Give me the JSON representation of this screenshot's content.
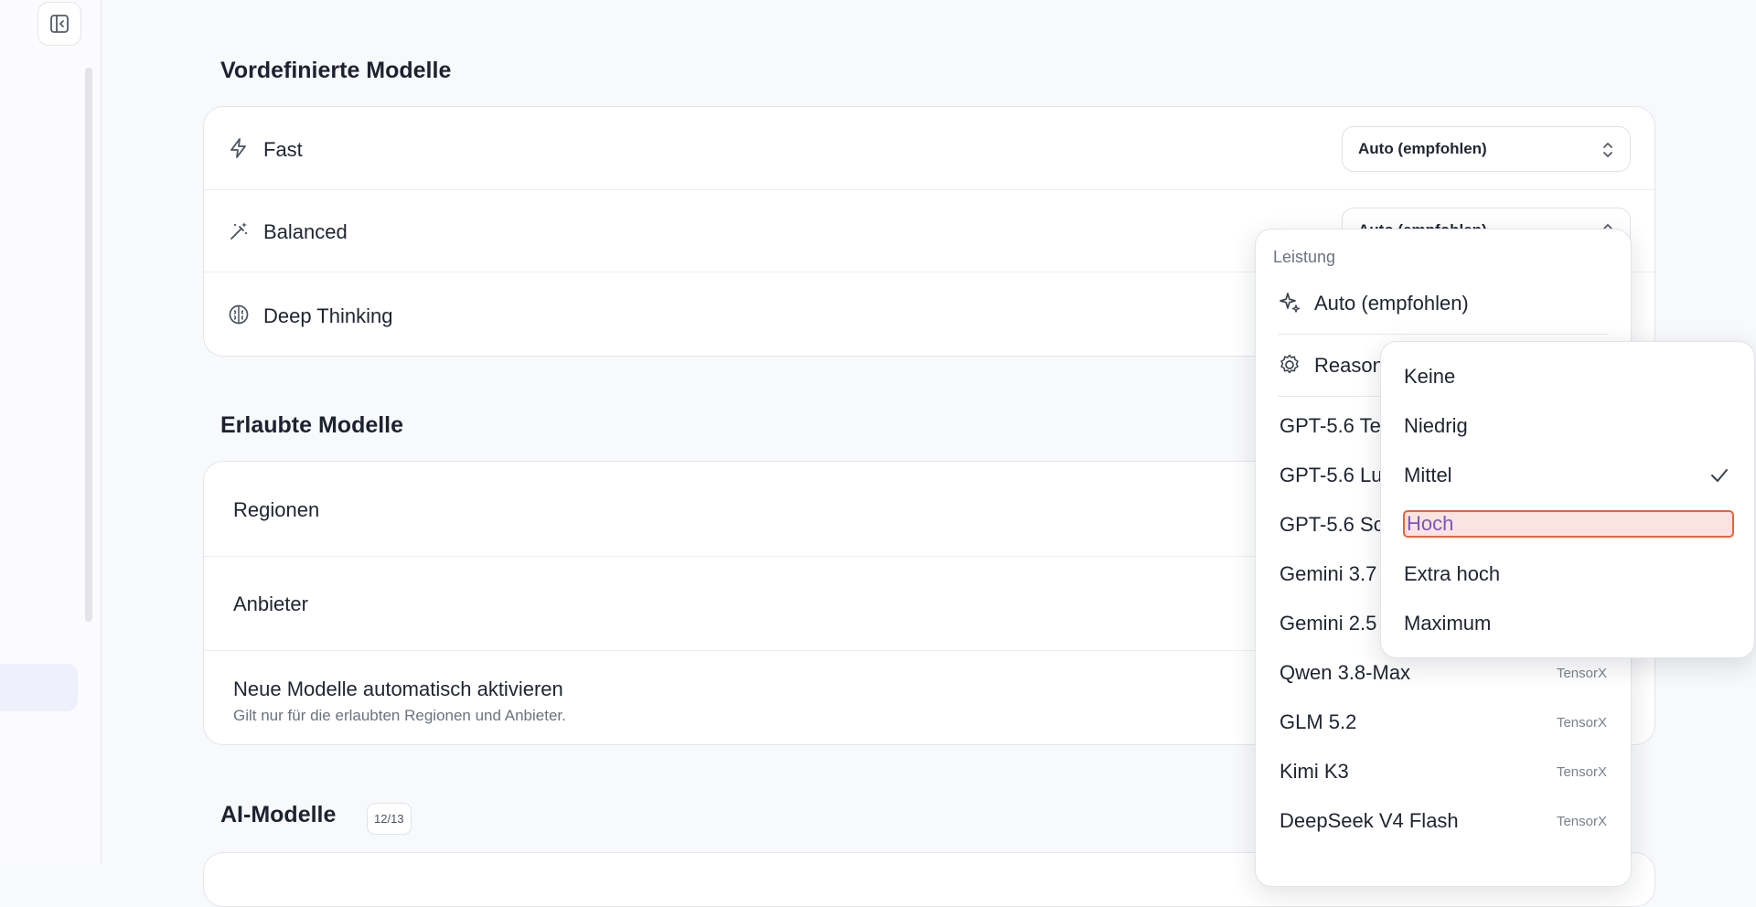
{
  "sections": {
    "predefined_title": "Vordefinierte Modelle",
    "allowed_title": "Erlaubte Modelle",
    "ai_models_title": "AI-Modelle",
    "ai_models_count": "12/13"
  },
  "predefined": {
    "fast": {
      "label": "Fast",
      "icon": "lightning-icon",
      "value": "Auto (empfohlen)"
    },
    "balanced": {
      "label": "Balanced",
      "icon": "magic-wand-icon",
      "value": "Auto (empfohlen)"
    },
    "deep": {
      "label": "Deep Thinking",
      "icon": "brain-icon"
    }
  },
  "allowed": {
    "regions": "Regionen",
    "providers": "Anbieter",
    "auto_enable": "Neue Modelle automatisch aktivieren",
    "auto_enable_hint": "Gilt nur für die erlaubten Regionen und Anbieter."
  },
  "dropdown": {
    "group": "Leistung",
    "auto": "Auto (empfohlen)",
    "reasoning": "Reasoning",
    "models": [
      {
        "name": "GPT-5.6 Te",
        "provider": ""
      },
      {
        "name": "GPT-5.6 Lu",
        "provider": ""
      },
      {
        "name": "GPT-5.6 Sc",
        "provider": ""
      },
      {
        "name": "Gemini 3.7",
        "provider": ""
      },
      {
        "name": "Gemini 2.5",
        "provider": ""
      },
      {
        "name": "Qwen 3.8-Max",
        "provider": "TensorX"
      },
      {
        "name": "GLM 5.2",
        "provider": "TensorX"
      },
      {
        "name": "Kimi K3",
        "provider": "TensorX"
      },
      {
        "name": "DeepSeek V4 Flash",
        "provider": "TensorX"
      }
    ]
  },
  "reasoning_levels": {
    "options": [
      "Keine",
      "Niedrig",
      "Mittel",
      "Hoch",
      "Extra hoch",
      "Maximum"
    ],
    "selected": "Mittel",
    "hovered": "Hoch"
  },
  "colors": {
    "highlight_border": "#e8643c",
    "highlight_fill": "#fbe3e1",
    "highlight_text": "#7d56b8"
  }
}
